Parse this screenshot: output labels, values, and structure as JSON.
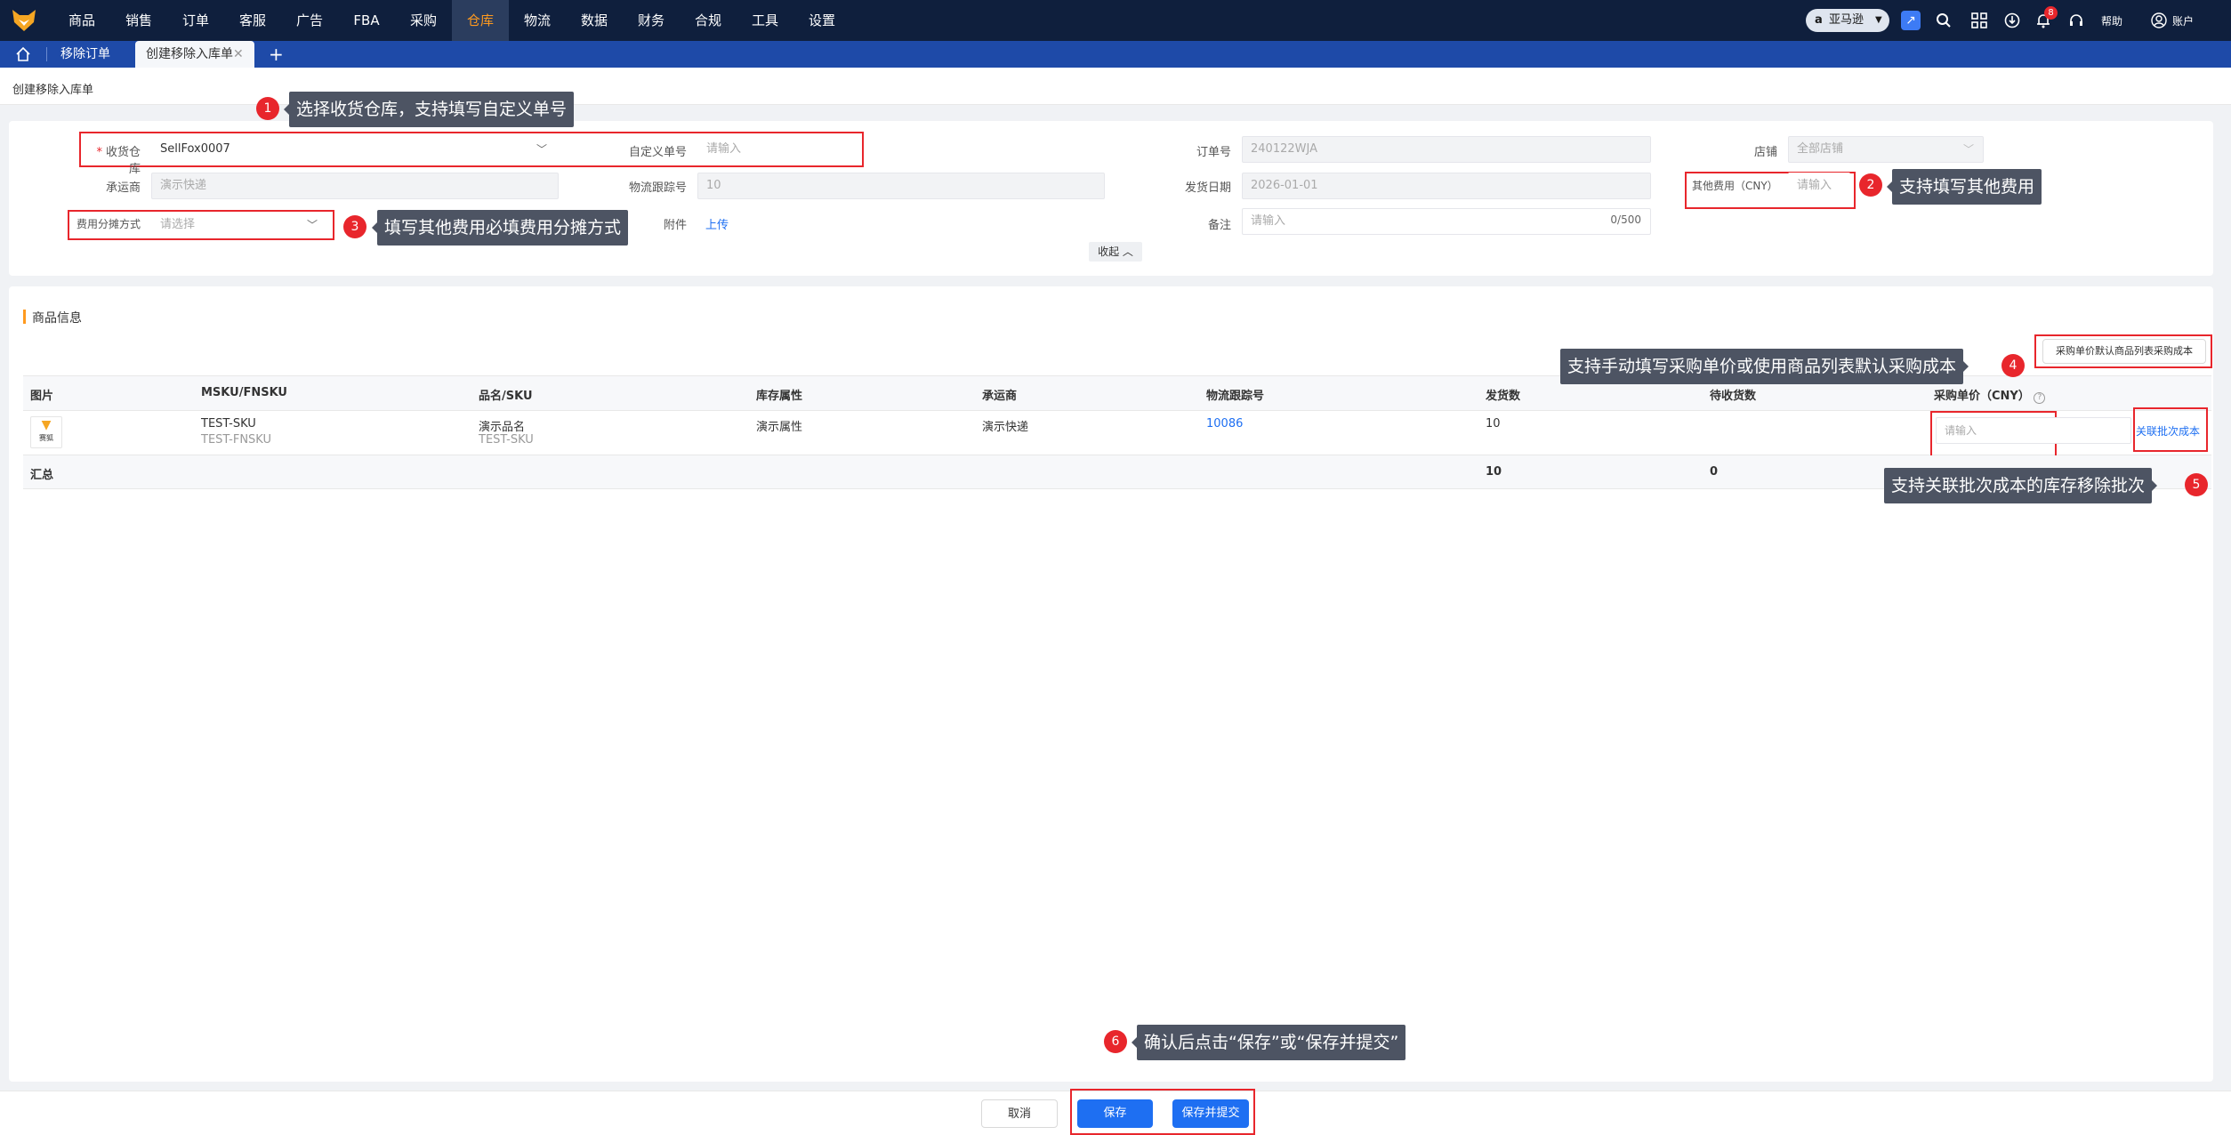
{
  "nav": {
    "items": [
      "商品",
      "销售",
      "订单",
      "客服",
      "广告",
      "FBA",
      "采购",
      "仓库",
      "物流",
      "数据",
      "财务",
      "合规",
      "工具",
      "设置"
    ],
    "active_index": 7,
    "marketplace": "亚马逊",
    "notification_count": "8",
    "help": "帮助",
    "account": "账户"
  },
  "tabs": {
    "items": [
      "移除订单",
      "创建移除入库单"
    ],
    "active_index": 1,
    "add": "+"
  },
  "page_title": "创建移除入库单",
  "form": {
    "warehouse": {
      "required_mark": "*",
      "label": "收货仓库",
      "value": "SellFox0007"
    },
    "custom_no": {
      "label": "自定义单号",
      "placeholder": "请输入"
    },
    "order_no": {
      "label": "订单号",
      "value": "240122WJA"
    },
    "shop": {
      "label": "店铺",
      "value": "全部店铺"
    },
    "carrier": {
      "label": "承运商",
      "value": "演示快递"
    },
    "tracking": {
      "label": "物流跟踪号",
      "value": "10"
    },
    "ship_date": {
      "label": "发货日期",
      "value": "2026-01-01"
    },
    "other_fee": {
      "label": "其他费用（CNY）",
      "placeholder": "请输入"
    },
    "fee_alloc": {
      "label": "费用分摊方式",
      "placeholder": "请选择"
    },
    "attachment": {
      "label": "附件",
      "action": "上传"
    },
    "remark": {
      "label": "备注",
      "placeholder": "请输入",
      "counter": "0/500"
    },
    "collapse": "收起"
  },
  "products": {
    "section_title": "商品信息",
    "default_cost_button": "采购单价默认商品列表采购成本",
    "columns": [
      "图片",
      "MSKU/FNSKU",
      "品名/SKU",
      "库存属性",
      "承运商",
      "物流跟踪号",
      "发货数",
      "待收货数",
      "采购单价（CNY）"
    ],
    "row": {
      "thumb_text": "赛狐",
      "msku": "TEST-SKU",
      "fnsku": "TEST-FNSKU",
      "name": "演示品名",
      "sku": "TEST-SKU",
      "stock_attr": "演示属性",
      "carrier": "演示快递",
      "tracking": "10086",
      "shipped": "10",
      "price_placeholder": "请输入",
      "link_batch": "关联批次成本"
    },
    "summary": {
      "label": "汇总",
      "shipped": "10",
      "pending": "0"
    }
  },
  "tips": {
    "t1": {
      "num": "1",
      "text": "选择收货仓库，支持填写自定义单号"
    },
    "t2": {
      "num": "2",
      "text": "支持填写其他费用"
    },
    "t3": {
      "num": "3",
      "text": "填写其他费用必填费用分摊方式"
    },
    "t4": {
      "num": "4",
      "text": "支持手动填写采购单价或使用商品列表默认采购成本"
    },
    "t5": {
      "num": "5",
      "text": "支持关联批次成本的库存移除批次"
    },
    "t6": {
      "num": "6",
      "text": "确认后点击“保存”或“保存并提交”"
    }
  },
  "footer": {
    "cancel": "取消",
    "save": "保存",
    "save_submit": "保存并提交"
  },
  "colors": {
    "nav_bg": "#0f1f3d",
    "tab_bg": "#1e4aa8",
    "accent": "#ff9a1f",
    "primary": "#1e6ff2",
    "highlight": "#e8262c"
  }
}
